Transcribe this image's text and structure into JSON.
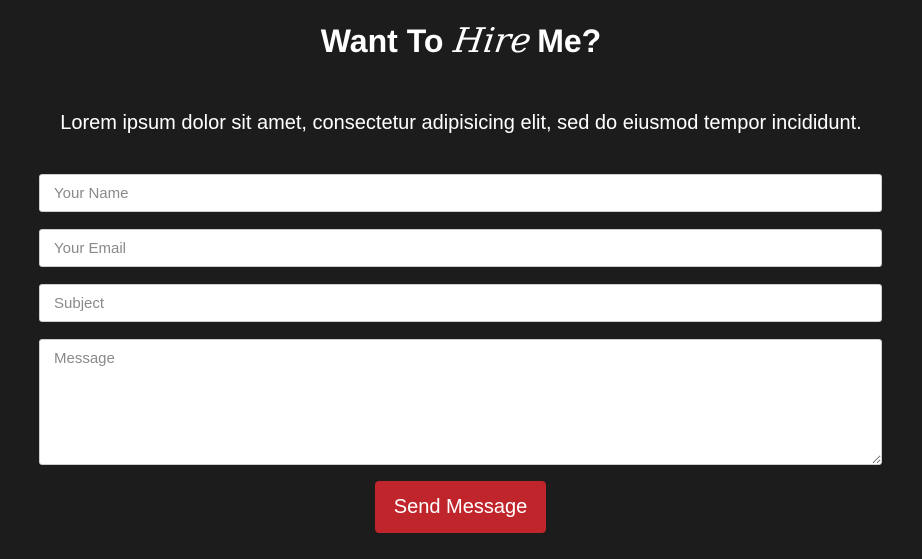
{
  "hero": {
    "title_prefix": "Want To",
    "title_emphasis": "Hire",
    "title_suffix": "Me?",
    "lead": "Lorem ipsum dolor sit amet, consectetur adipisicing elit, sed do eiusmod tempor incididunt."
  },
  "form": {
    "name_placeholder": "Your Name",
    "email_placeholder": "Your Email",
    "subject_placeholder": "Subject",
    "message_placeholder": "Message",
    "name_value": "",
    "email_value": "",
    "subject_value": "",
    "message_value": "",
    "submit_label": "Send Message"
  },
  "colors": {
    "background": "#1c1c1c",
    "accent": "#c0252b",
    "text": "#ffffff"
  }
}
